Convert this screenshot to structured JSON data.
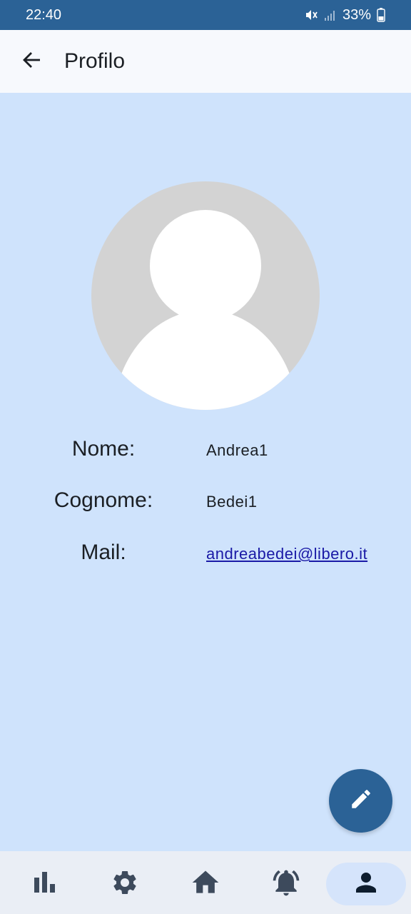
{
  "status_bar": {
    "time": "22:40",
    "battery": "33%",
    "icons": [
      "mute-icon",
      "signal-icon",
      "battery-icon"
    ]
  },
  "app_bar": {
    "title": "Profilo",
    "back_icon": "arrow-left-icon"
  },
  "profile": {
    "avatar_icon": "default-avatar-icon",
    "fields": [
      {
        "label": "Nome:",
        "value": "Andrea1"
      },
      {
        "label": "Cognome:",
        "value": "Bedei1"
      },
      {
        "label": "Mail:",
        "value": "andreabedei@libero.it"
      }
    ]
  },
  "fab": {
    "icon": "pencil-icon"
  },
  "bottom_nav": {
    "items": [
      {
        "icon": "bar-chart-icon"
      },
      {
        "icon": "gear-icon"
      },
      {
        "icon": "home-icon"
      },
      {
        "icon": "bell-ring-icon"
      },
      {
        "icon": "person-icon",
        "active": true
      }
    ]
  },
  "colors": {
    "primary": "#2b6296",
    "background": "#cfe3fc",
    "appbar": "#f7f9fd",
    "nav_bg": "#eaeef5",
    "nav_active": "#d5e4fb",
    "link": "#1a1aa6"
  }
}
